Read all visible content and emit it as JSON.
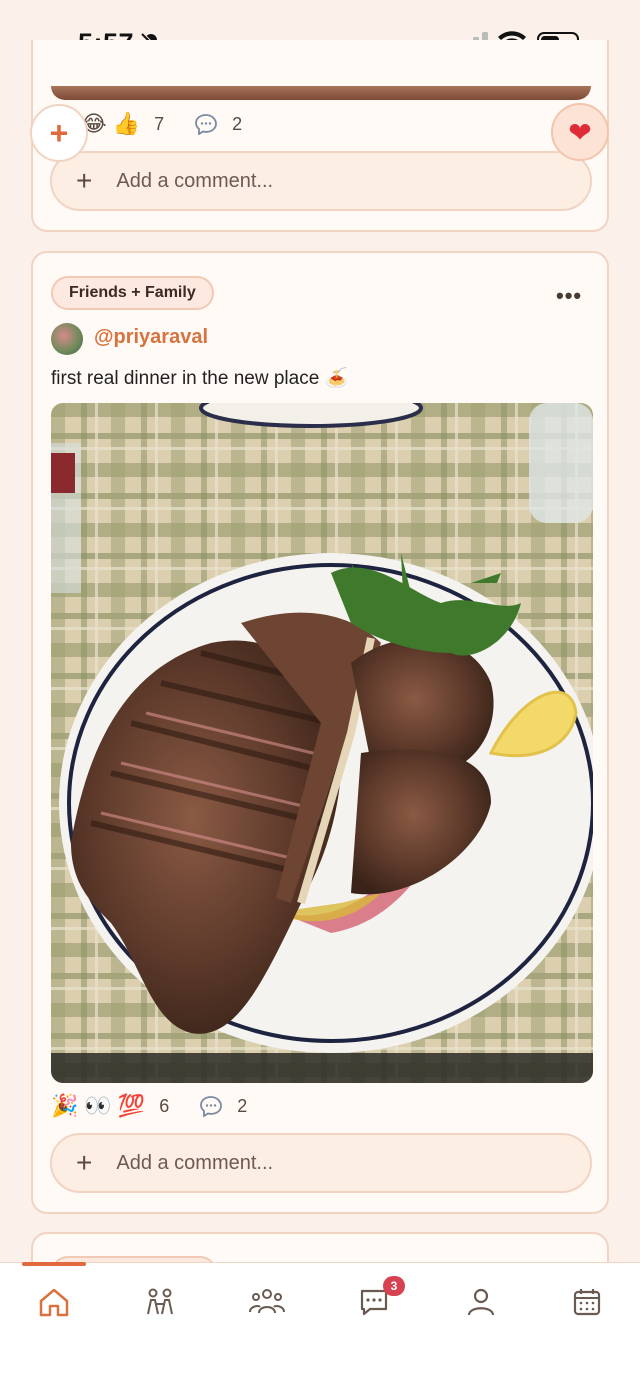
{
  "status_bar": {
    "time": "5:57",
    "icons": [
      "bell-slash-icon",
      "cellular-signal-icon",
      "wifi-icon",
      "battery-icon"
    ]
  },
  "prev_post": {
    "reactions": {
      "emojis": [
        "😂",
        "👍"
      ],
      "count": "7",
      "comment_count": "2"
    },
    "comment_placeholder": "Add a comment..."
  },
  "floating": {
    "add_icon": "plus-icon",
    "add_symbol": "+",
    "heart_icon": "heart-icon",
    "heart_symbol": "❤"
  },
  "post": {
    "audience": "Friends + Family",
    "more_symbol": "•••",
    "username": "@priyaraval",
    "caption": "first real dinner in the new place 🍝",
    "photo": "T-bone steak sliced on a white plate with arugula and lemon on a plaid tablecloth",
    "reactions": {
      "emojis": [
        "🎉",
        "👀",
        "💯"
      ],
      "count": "6",
      "comment_count": "2"
    },
    "comment_placeholder": "Add a comment..."
  },
  "tabbar": {
    "tabs": [
      "home-icon",
      "couple-icon",
      "groups-icon",
      "messages-icon",
      "profile-icon",
      "calendar-icon"
    ],
    "messages_badge": "3"
  },
  "colors": {
    "accent": "#e06a3d",
    "background": "#fbf1ea",
    "card_border": "#f1d3c2",
    "badge": "#d64250"
  }
}
